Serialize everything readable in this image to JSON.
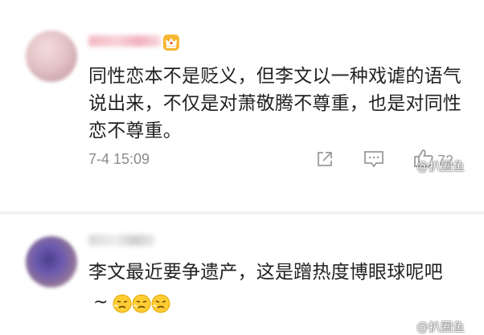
{
  "comments": [
    {
      "text": "同性恋本不是贬义，但李文以一种戏谑的语气说出来，不仅是对萧敬腾不尊重，也是对同性恋不尊重。",
      "timestamp": "7-4 15:09",
      "likes": "72",
      "user_badge_icon": "crown-badge-icon"
    },
    {
      "text": "李文最近要争遗产，这是蹭热度博眼球呢吧",
      "tail": "~",
      "emojis": [
        "huffing-face-emoji",
        "huffing-face-emoji",
        "huffing-face-emoji"
      ]
    }
  ],
  "actions": {
    "share_icon": "share-icon",
    "reply_icon": "comment-icon",
    "like_icon": "thumbs-up-icon"
  },
  "watermark": "@扒圈鱼",
  "colors": {
    "text": "#222222",
    "meta": "#8a8a8a",
    "crown": "#f0a020"
  }
}
